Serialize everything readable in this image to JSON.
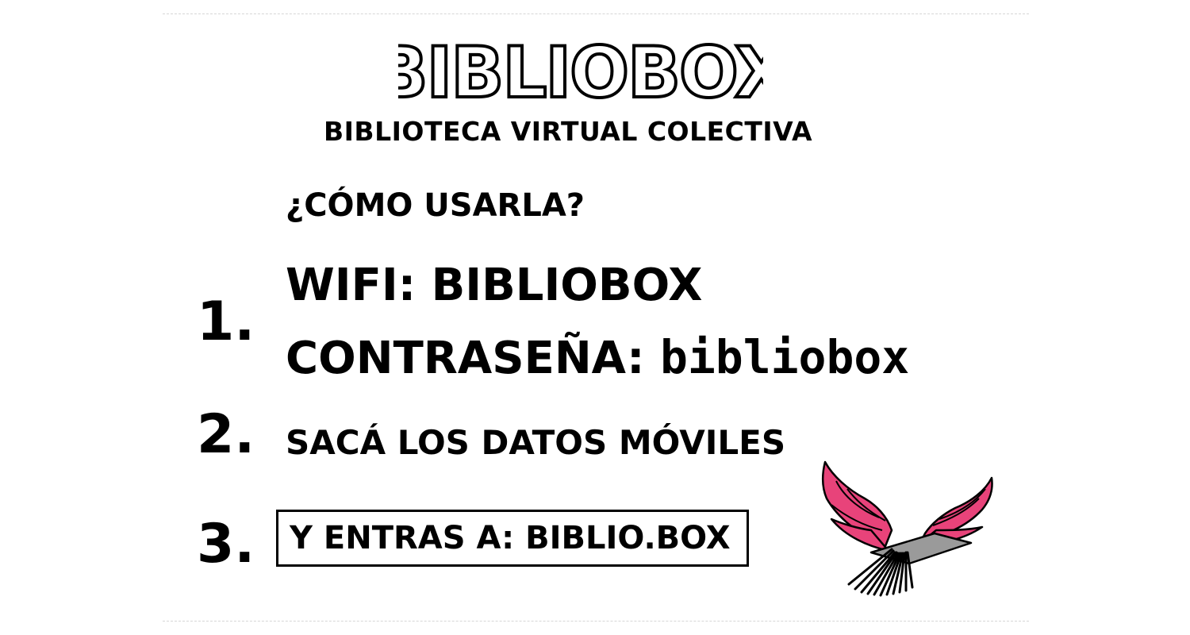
{
  "header": {
    "logo_text": "BIBLIOBOX",
    "subtitle": "BIBLIOTECA VIRTUAL COLECTIVA"
  },
  "instructions": {
    "heading": "¿CÓMO USARLA?",
    "steps": [
      {
        "number": "1.",
        "wifi_label": "WIFI: BIBLIOBOX",
        "password_label": "CONTRASEÑA: ",
        "password_value": "bibliobox"
      },
      {
        "number": "2.",
        "text": "SACÁ LOS DATOS MÓVILES"
      },
      {
        "number": "3.",
        "text": "Y ENTRAS A: BIBLIO.BOX"
      }
    ]
  },
  "illustration": {
    "icon": "winged-book-icon",
    "wing_color": "#e8437a",
    "book_color": "#9a9a9a"
  }
}
